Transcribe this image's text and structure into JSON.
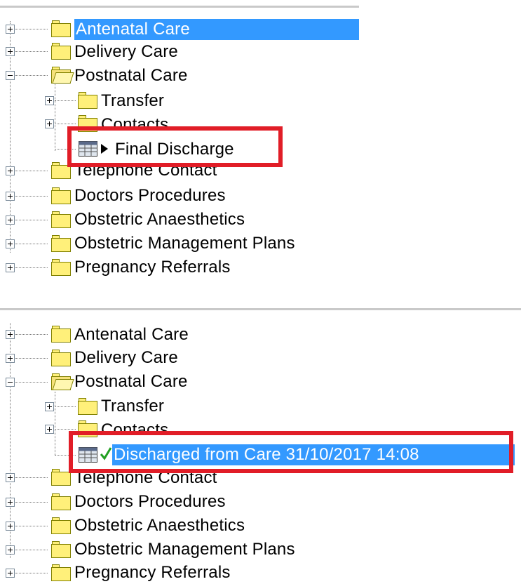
{
  "colors": {
    "selection": "#3399ff",
    "highlight_box": "#e11d27",
    "folder": "#fff07a",
    "check": "#22a022"
  },
  "top_tree": {
    "items": [
      {
        "label": "Antenatal Care",
        "selected": true
      },
      {
        "label": "Delivery Care"
      },
      {
        "label": "Postnatal Care",
        "expanded": true
      },
      {
        "label": "Transfer"
      },
      {
        "label": "Contacts"
      },
      {
        "label": "Final Discharge",
        "icon": "form-icon",
        "status_icon": "arrow-icon"
      },
      {
        "label": "Telephone Contact"
      },
      {
        "label": "Doctors Procedures"
      },
      {
        "label": "Obstetric Anaesthetics"
      },
      {
        "label": "Obstetric Management Plans"
      },
      {
        "label": "Pregnancy Referrals"
      }
    ]
  },
  "bottom_tree": {
    "items": [
      {
        "label": "Antenatal Care"
      },
      {
        "label": "Delivery Care"
      },
      {
        "label": "Postnatal Care",
        "expanded": true
      },
      {
        "label": "Transfer"
      },
      {
        "label": "Contacts"
      },
      {
        "label": "Discharged from Care 31/10/2017 14:08",
        "icon": "form-icon",
        "status_icon": "check-icon",
        "selected": true
      },
      {
        "label": "Telephone Contact"
      },
      {
        "label": "Doctors Procedures"
      },
      {
        "label": "Obstetric Anaesthetics"
      },
      {
        "label": "Obstetric Management Plans"
      },
      {
        "label": "Pregnancy Referrals"
      }
    ]
  }
}
